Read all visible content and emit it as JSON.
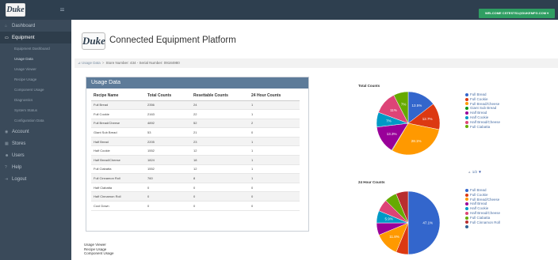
{
  "topbar": {
    "logo_text": "Duke",
    "welcome": "WELCOME CSTESTS1@DUKEMFG.COM ▾"
  },
  "sidebar": {
    "items": [
      {
        "label": "Dashboard",
        "icon": "home-icon"
      },
      {
        "label": "Equipment",
        "icon": "monitor-icon",
        "active": true
      },
      {
        "label": "Account",
        "icon": "user-icon"
      },
      {
        "label": "Stores",
        "icon": "building-icon"
      },
      {
        "label": "Users",
        "icon": "users-icon"
      },
      {
        "label": "Help",
        "icon": "help-icon"
      },
      {
        "label": "Logout",
        "icon": "logout-icon"
      }
    ],
    "equipment_sub": [
      "Equipment Dashboard",
      "Usage Data",
      "Usage Viewer",
      "Recipe Usage",
      "Component Usage",
      "Diagnostics",
      "System Status",
      "Configuration Data"
    ]
  },
  "page": {
    "logo_text": "Duke",
    "title": "Connected Equipment Platform",
    "breadcrumb": {
      "link": "Usage Data",
      "separator": ">",
      "store": "Store Number: 434 - Serial Number: 09184980"
    }
  },
  "usage": {
    "title": "Usage Data",
    "columns": [
      "Recipe Name",
      "Total Counts",
      "Resettable Counts",
      "24 Hour Counts"
    ],
    "rows": [
      [
        "Full Bread",
        "2356",
        "24",
        "1"
      ],
      [
        "Full Cookie",
        "2163",
        "22",
        "1"
      ],
      [
        "Full Bread/Cheese",
        "4892",
        "52",
        "2"
      ],
      [
        "Giant Sub Bread",
        "53",
        "21",
        "0"
      ],
      [
        "Half Bread",
        "2205",
        "23",
        "1"
      ],
      [
        "Half Cookie",
        "1552",
        "12",
        "1"
      ],
      [
        "Half Bread/Cheese",
        "1824",
        "18",
        "1"
      ],
      [
        "Full Ciabatta",
        "1552",
        "12",
        "1"
      ],
      [
        "Full Cinnamon Roll",
        "760",
        "8",
        "1"
      ],
      [
        "Half Ciabatta",
        "0",
        "0",
        "0"
      ],
      [
        "Half Cinnamon Roll",
        "0",
        "0",
        "0"
      ],
      [
        "Cool Down",
        "0",
        "0",
        "0"
      ]
    ]
  },
  "bottom_links": [
    "Usage Viewer",
    "Recipe Usage",
    "Component Usage"
  ],
  "charts": {
    "total": {
      "title": "Total Counts",
      "colors": [
        "#3366cc",
        "#dc3912",
        "#ff9900",
        "#109618",
        "#990099",
        "#0099c6",
        "#dd4477",
        "#66aa00"
      ],
      "legend": [
        "Full Bread",
        "Full Cookie",
        "Full Bread/Cheese",
        "Giant Sub Bread",
        "Half Bread",
        "Half Cookie",
        "Half Bread/Cheese",
        "Full Ciabatta"
      ],
      "pager": "1/2",
      "slice_labels": [
        {
          "text": "13.5%",
          "slice": 0
        },
        {
          "text": "12.7%",
          "slice": 1
        },
        {
          "text": "28.1%",
          "slice": 2
        },
        {
          "text": "13.3%",
          "slice": 4
        },
        {
          "text": "7%",
          "slice": 5
        },
        {
          "text": "11%",
          "slice": 6
        },
        {
          "text": "7%",
          "slice": 7
        }
      ]
    },
    "hour": {
      "title": "24 Hour Counts",
      "colors": [
        "#3366cc",
        "#dc3912",
        "#ff9900",
        "#990099",
        "#0099c6",
        "#dd4477",
        "#66aa00",
        "#b82e2e",
        "#316395"
      ],
      "legend": [
        "Full Bread",
        "Full Cookie",
        "Full Bread/Cheese",
        "Half Bread",
        "Half Cookie",
        "Half Bread/Cheese",
        "Full Ciabatta",
        "Full Cinnamon Roll",
        ""
      ],
      "slice_labels": [
        {
          "text": "47.1%",
          "slice": 0
        },
        {
          "text": "11.8%",
          "slice": 2
        },
        {
          "text": "5.9%",
          "slice": 4
        }
      ]
    }
  },
  "chart_data": [
    {
      "type": "pie",
      "title": "Total Counts",
      "categories": [
        "Full Bread",
        "Full Cookie",
        "Full Bread/Cheese",
        "Giant Sub Bread",
        "Half Bread",
        "Half Cookie",
        "Half Bread/Cheese",
        "Full Ciabatta"
      ],
      "values": [
        13.5,
        12.7,
        28.1,
        0.3,
        13.3,
        7.0,
        11.0,
        7.0
      ]
    },
    {
      "type": "pie",
      "title": "24 Hour Counts",
      "categories": [
        "Full Bread",
        "Full Cookie",
        "Full Bread/Cheese",
        "Half Bread",
        "Half Cookie",
        "Half Bread/Cheese",
        "Full Ciabatta",
        "Full Cinnamon Roll"
      ],
      "values": [
        47.1,
        5.9,
        11.8,
        5.9,
        5.9,
        5.9,
        5.9,
        5.9
      ]
    }
  ]
}
